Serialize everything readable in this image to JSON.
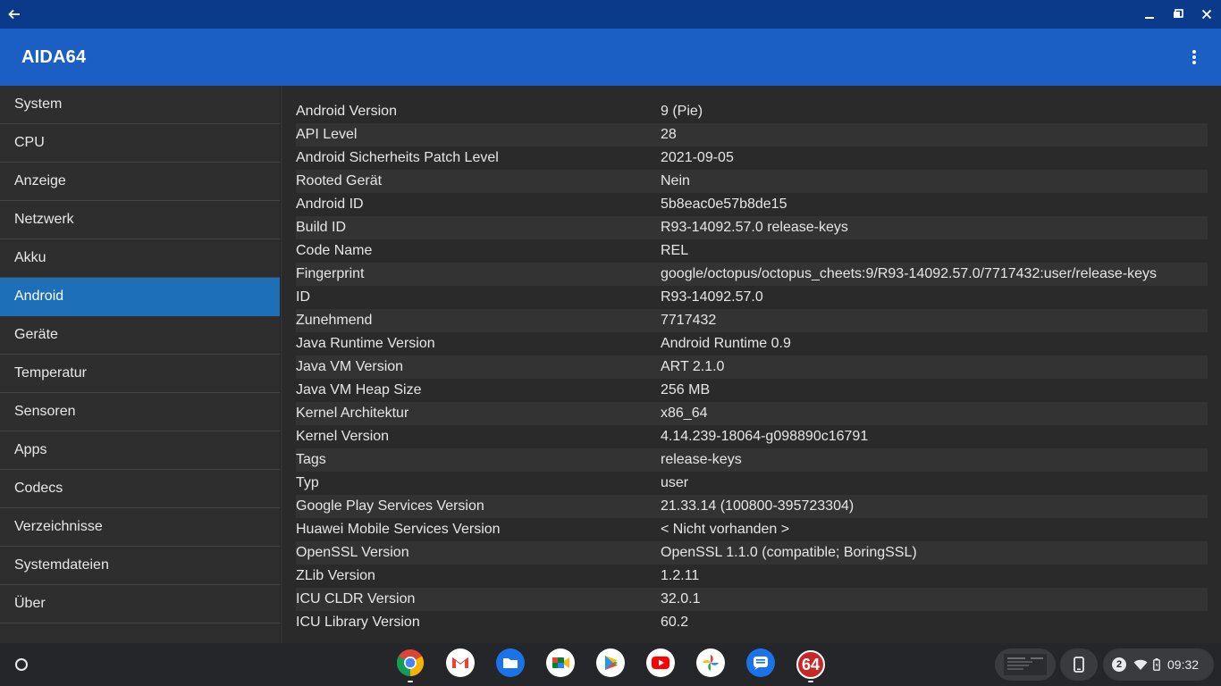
{
  "window": {
    "back_icon": "arrow-left-icon",
    "minimize_icon": "minimize-icon",
    "restore_icon": "restore-icon",
    "close_icon": "close-icon"
  },
  "appbar": {
    "title": "AIDA64",
    "menu_icon": "more-vert-icon"
  },
  "sidebar": {
    "items": [
      {
        "label": "System"
      },
      {
        "label": "CPU"
      },
      {
        "label": "Anzeige"
      },
      {
        "label": "Netzwerk"
      },
      {
        "label": "Akku"
      },
      {
        "label": "Android",
        "active": true
      },
      {
        "label": "Geräte"
      },
      {
        "label": "Temperatur"
      },
      {
        "label": "Sensoren"
      },
      {
        "label": "Apps"
      },
      {
        "label": "Codecs"
      },
      {
        "label": "Verzeichnisse"
      },
      {
        "label": "Systemdateien"
      },
      {
        "label": "Über"
      }
    ]
  },
  "details": [
    {
      "key": "Android Version",
      "value": "9 (Pie)"
    },
    {
      "key": "API Level",
      "value": "28"
    },
    {
      "key": "Android Sicherheits Patch Level",
      "value": "2021-09-05"
    },
    {
      "key": "Rooted Gerät",
      "value": "Nein"
    },
    {
      "key": "Android ID",
      "value": "5b8eac0e57b8de15"
    },
    {
      "key": "Build ID",
      "value": "R93-14092.57.0 release-keys"
    },
    {
      "key": "Code Name",
      "value": "REL"
    },
    {
      "key": "Fingerprint",
      "value": "google/octopus/octopus_cheets:9/R93-14092.57.0/7717432:user/release-keys"
    },
    {
      "key": "ID",
      "value": "R93-14092.57.0"
    },
    {
      "key": "Zunehmend",
      "value": "7717432"
    },
    {
      "key": "Java Runtime Version",
      "value": "Android Runtime 0.9"
    },
    {
      "key": "Java VM Version",
      "value": "ART 2.1.0"
    },
    {
      "key": "Java VM Heap Size",
      "value": "256 MB"
    },
    {
      "key": "Kernel Architektur",
      "value": "x86_64"
    },
    {
      "key": "Kernel Version",
      "value": "4.14.239-18064-g098890c16791"
    },
    {
      "key": "Tags",
      "value": "release-keys"
    },
    {
      "key": "Typ",
      "value": "user"
    },
    {
      "key": "Google Play Services Version",
      "value": "21.33.14 (100800-395723304)"
    },
    {
      "key": "Huawei Mobile Services Version",
      "value": "< Nicht vorhanden >"
    },
    {
      "key": "OpenSSL Version",
      "value": "OpenSSL 1.1.0 (compatible; BoringSSL)"
    },
    {
      "key": "ZLib Version",
      "value": "1.2.11"
    },
    {
      "key": "ICU CLDR Version",
      "value": "32.0.1"
    },
    {
      "key": "ICU Library Version",
      "value": "60.2"
    }
  ],
  "shelf": {
    "launcher_icon": "launcher-circle-icon",
    "apps": [
      {
        "name": "chrome-icon",
        "color": "#4285f4"
      },
      {
        "name": "gmail-icon",
        "color": "#ffffff"
      },
      {
        "name": "files-icon",
        "color": "#1a73e8"
      },
      {
        "name": "meet-icon",
        "color": "#ffffff"
      },
      {
        "name": "play-store-icon",
        "color": "#ffffff"
      },
      {
        "name": "youtube-icon",
        "color": "#ff0000"
      },
      {
        "name": "photos-icon",
        "color": "#ffffff"
      },
      {
        "name": "messages-icon",
        "color": "#1a73e8"
      },
      {
        "name": "aida64-icon",
        "label": "64",
        "color": "#c62828"
      }
    ],
    "notification_count": "2",
    "time": "09:32",
    "phone_hub_icon": "phone-icon",
    "wifi_icon": "wifi-icon",
    "battery_icon": "battery-icon"
  }
}
